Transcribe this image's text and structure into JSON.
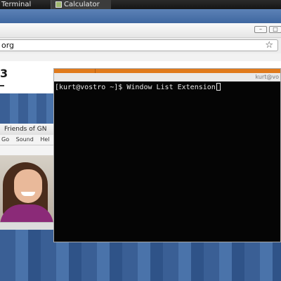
{
  "taskbar": {
    "items": [
      {
        "label": "Terminal"
      },
      {
        "label": "Calculator"
      }
    ]
  },
  "browser": {
    "url": "org",
    "logo_fragment": "3"
  },
  "friends_window": {
    "title": "Friends of GN",
    "menu": [
      "Go",
      "Sound",
      "Hel"
    ]
  },
  "terminal": {
    "title": "kurt@vo",
    "prompt": "[kurt@vostro ~]$ ",
    "command": "Window List Extension"
  },
  "colors": {
    "terminal_accent": "#e07a1c",
    "desktop_blue": "#3a5f95"
  }
}
